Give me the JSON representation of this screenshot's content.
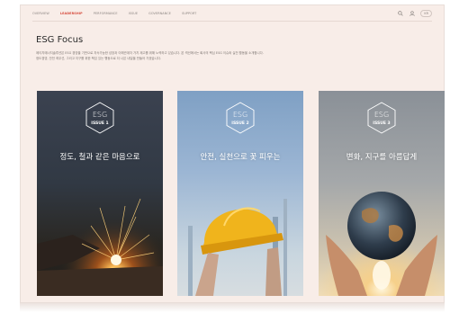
{
  "nav": {
    "items": [
      "OVERVIEW",
      "LEADERSHIP",
      "PERFORMANCE",
      "ISSUE",
      "GOVERNANCE",
      "SUPPORT"
    ],
    "active_index": 1,
    "language": "KR",
    "icons": [
      "search-icon",
      "user-icon",
      "language-icon"
    ]
  },
  "page": {
    "title": "ESG Focus",
    "description_line1": "에이치에너지솔루션은 ESG 경영을 기반으로 지속가능한 성장과 이해관계자 가치 제고를 위해 노력하고 있습니다. 본 섹션에서는 회사의 핵심 ESG 이슈와 실천 활동을 소개합니다.",
    "description_line2": "정도경영, 안전 최우선, 그리고 지구를 위한 책임 있는 행동으로 더 나은 내일을 만들어 가겠습니다."
  },
  "cards": [
    {
      "label": "ESG",
      "issue": "ISSUE 1",
      "phrase": "정도, 철과 같은 마음으로"
    },
    {
      "label": "ESG",
      "issue": "ISSUE 2",
      "phrase": "안전, 실천으로 꽃 피우는"
    },
    {
      "label": "ESG",
      "issue": "ISSUE 3",
      "phrase": "변화, 지구를 아름답게"
    }
  ],
  "colors": {
    "accent": "#d64a3c",
    "background": "#f8ede8"
  }
}
